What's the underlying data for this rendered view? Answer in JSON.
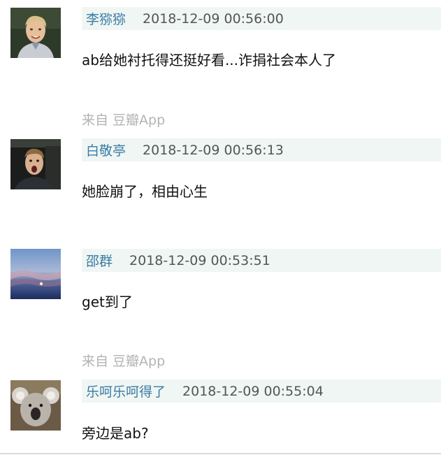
{
  "comments": [
    {
      "author": "李猕猕",
      "time": "2018-12-09 00:56:00",
      "text": "ab给她衬托得还挺好看...诈捐社会本人了",
      "avatar_icon": "young-man-avatar-icon",
      "source": "来自 豆瓣App"
    },
    {
      "author": "白敬亭",
      "time": "2018-12-09 00:56:13",
      "text": "她脸崩了，相由心生",
      "avatar_icon": "shouting-man-avatar-icon",
      "source": ""
    },
    {
      "author": "邵群",
      "time": "2018-12-09 00:53:51",
      "text": "get到了",
      "avatar_icon": "sunset-sky-avatar-icon",
      "source": "来自 豆瓣App"
    },
    {
      "author": "乐呵乐呵得了",
      "time": "2018-12-09 00:55:04",
      "text": "旁边是ab?",
      "avatar_icon": "koala-avatar-icon",
      "source": ""
    }
  ],
  "colors": {
    "author": "#3a7ca6",
    "meta_bg": "#f0f6f3",
    "source": "#b3b3b3"
  }
}
